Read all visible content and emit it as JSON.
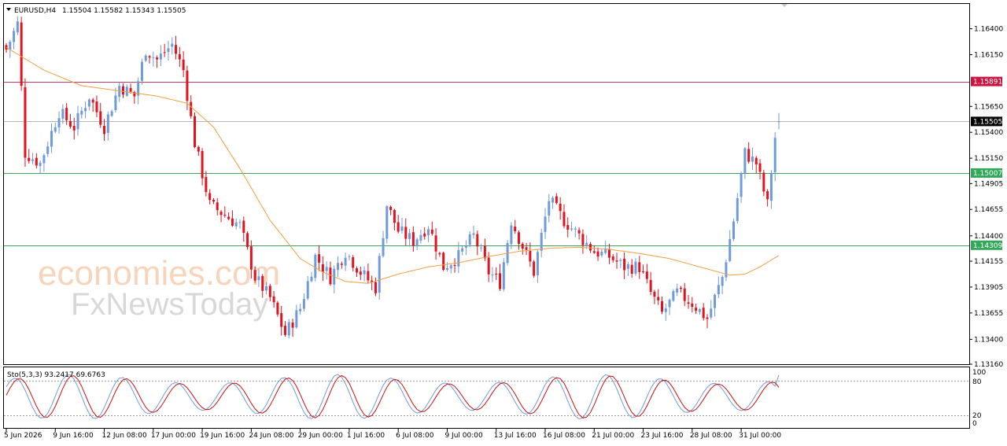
{
  "header": {
    "symbol_label": "EURUSD,H4",
    "ohlc": "1.15504 1.15582 1.15343 1.15505"
  },
  "watermark": {
    "brand": "economies.com",
    "brand2": "FxNewsToday"
  },
  "oscillator": {
    "label": "Sto(5,3,3) 93.2417 69.6763",
    "levels": [
      "100",
      "80",
      "20",
      "0"
    ]
  },
  "colors": {
    "bull": "#6f9bdc",
    "bear": "#e0141e",
    "ma": "#f0a040",
    "resistance": "#c0396b",
    "support": "#3aa55f",
    "current": "#b8b8b8",
    "stoch_main": "#6f9bdc",
    "stoch_signal": "#cc1010"
  },
  "chart_data": {
    "type": "candlestick",
    "symbol": "EURUSD",
    "timeframe": "H4",
    "y_ticks": [
      "1.16400",
      "1.16150",
      "1.15650",
      "1.15400",
      "1.15150",
      "1.14905",
      "1.14655",
      "1.14400",
      "1.14155",
      "1.13905",
      "1.13655",
      "1.13400",
      "1.13160"
    ],
    "ylim": [
      1.1316,
      1.1664
    ],
    "x_tick_labels": [
      "5 Jun 2026",
      "9 Jun 16:00",
      "12 Jun 08:00",
      "17 Jun 00:00",
      "19 Jun 16:00",
      "24 Jun 08:00",
      "29 Jun 00:00",
      "1 Jul 16:00",
      "6 Jul 08:00",
      "9 Jul 00:00",
      "13 Jul 16:00",
      "16 Jul 08:00",
      "21 Jul 00:00",
      "23 Jul 16:00",
      "28 Jul 08:00",
      "31 Jul 00:00"
    ],
    "horizontal_levels": [
      {
        "value": 1.15891,
        "label": "1.15891",
        "kind": "resistance"
      },
      {
        "value": 1.15505,
        "label": "1.15505",
        "kind": "current"
      },
      {
        "value": 1.15007,
        "label": "1.15007",
        "kind": "support"
      },
      {
        "value": 1.14309,
        "label": "1.14309",
        "kind": "support"
      }
    ],
    "close_path": [
      [
        0,
        1.162
      ],
      [
        3,
        1.1645
      ],
      [
        5,
        1.152
      ],
      [
        9,
        1.151
      ],
      [
        14,
        1.156
      ],
      [
        18,
        1.1545
      ],
      [
        22,
        1.1575
      ],
      [
        26,
        1.1545
      ],
      [
        30,
        1.1585
      ],
      [
        34,
        1.1575
      ],
      [
        37,
        1.162
      ],
      [
        40,
        1.161
      ],
      [
        44,
        1.1625
      ],
      [
        47,
        1.16
      ],
      [
        50,
        1.153
      ],
      [
        54,
        1.147
      ],
      [
        58,
        1.146
      ],
      [
        62,
        1.145
      ],
      [
        66,
        1.14
      ],
      [
        70,
        1.138
      ],
      [
        74,
        1.1345
      ],
      [
        78,
        1.137
      ],
      [
        82,
        1.142
      ],
      [
        86,
        1.14
      ],
      [
        90,
        1.1425
      ],
      [
        94,
        1.1405
      ],
      [
        98,
        1.139
      ],
      [
        101,
        1.147
      ],
      [
        104,
        1.1445
      ],
      [
        108,
        1.1435
      ],
      [
        112,
        1.145
      ],
      [
        116,
        1.141
      ],
      [
        120,
        1.142
      ],
      [
        124,
        1.144
      ],
      [
        128,
        1.1405
      ],
      [
        131,
        1.1395
      ],
      [
        134,
        1.1455
      ],
      [
        137,
        1.143
      ],
      [
        140,
        1.1405
      ],
      [
        144,
        1.1475
      ],
      [
        148,
        1.1455
      ],
      [
        152,
        1.144
      ],
      [
        156,
        1.1425
      ],
      [
        160,
        1.142
      ],
      [
        164,
        1.141
      ],
      [
        168,
        1.141
      ],
      [
        171,
        1.1385
      ],
      [
        174,
        1.1365
      ],
      [
        178,
        1.1385
      ],
      [
        182,
        1.1375
      ],
      [
        186,
        1.136
      ],
      [
        190,
        1.14
      ],
      [
        193,
        1.1455
      ],
      [
        196,
        1.152
      ],
      [
        199,
        1.151
      ],
      [
        202,
        1.147
      ],
      [
        204,
        1.1535
      ],
      [
        205,
        1.155
      ]
    ],
    "ma_path": [
      [
        0,
        1.1622
      ],
      [
        10,
        1.16
      ],
      [
        20,
        1.1585
      ],
      [
        30,
        1.158
      ],
      [
        40,
        1.1575
      ],
      [
        48,
        1.1568
      ],
      [
        55,
        1.1545
      ],
      [
        62,
        1.1505
      ],
      [
        70,
        1.1455
      ],
      [
        78,
        1.1418
      ],
      [
        84,
        1.1405
      ],
      [
        90,
        1.1396
      ],
      [
        96,
        1.1394
      ],
      [
        104,
        1.1403
      ],
      [
        112,
        1.141
      ],
      [
        120,
        1.1414
      ],
      [
        128,
        1.142
      ],
      [
        136,
        1.1425
      ],
      [
        144,
        1.1428
      ],
      [
        152,
        1.1429
      ],
      [
        160,
        1.1427
      ],
      [
        168,
        1.1423
      ],
      [
        176,
        1.1418
      ],
      [
        184,
        1.141
      ],
      [
        192,
        1.1402
      ],
      [
        196,
        1.1403
      ],
      [
        200,
        1.141
      ],
      [
        205,
        1.1421
      ]
    ]
  }
}
